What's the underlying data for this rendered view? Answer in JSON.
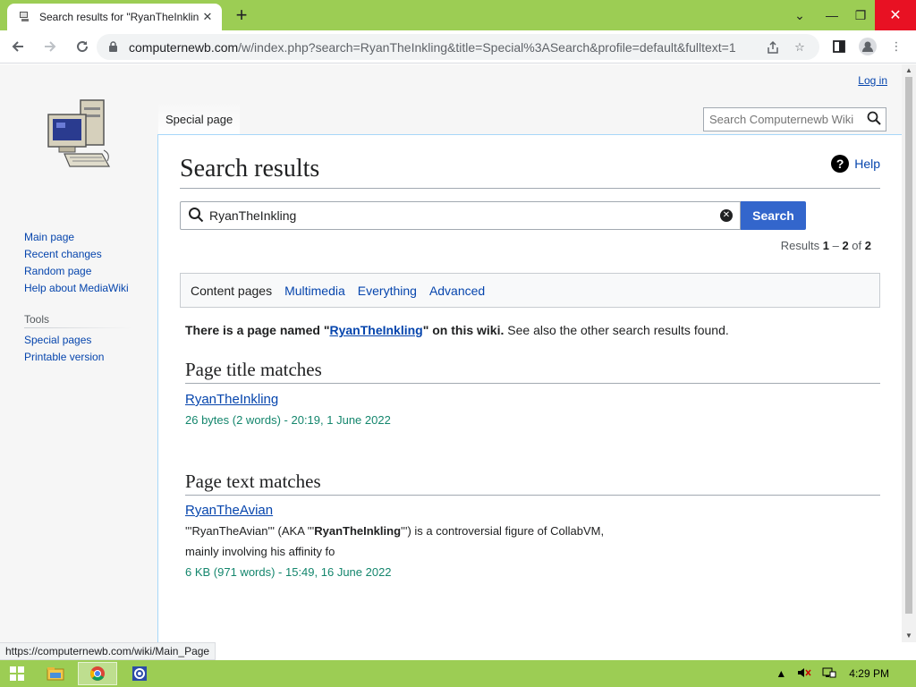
{
  "browser": {
    "tab_title": "Search results for \"RyanTheInklin",
    "url_host": "computernewb.com",
    "url_path": "/w/index.php?search=RyanTheInkling&title=Special%3ASearch&profile=default&fulltext=1",
    "status_url": "https://computernewb.com/wiki/Main_Page"
  },
  "wiki": {
    "login": "Log in",
    "namespace_tab": "Special page",
    "header_search_placeholder": "Search Computernewb Wiki",
    "sidebar": {
      "nav": [
        "Main page",
        "Recent changes",
        "Random page",
        "Help about MediaWiki"
      ],
      "tools_heading": "Tools",
      "tools": [
        "Special pages",
        "Printable version"
      ]
    },
    "page_title": "Search results",
    "help": "Help",
    "search_value": "RyanTheInkling",
    "search_button": "Search",
    "results_info": {
      "prefix": "Results ",
      "from": "1",
      "dash": " – ",
      "to": "2",
      "of": " of ",
      "total": "2"
    },
    "profiles": {
      "active": "Content pages",
      "links": [
        "Multimedia",
        "Everything",
        "Advanced"
      ]
    },
    "page_exists": {
      "before": "There is a page named \"",
      "link": "RyanTheInkling",
      "after": "\" on this wiki.",
      "rest": " See also the other search results found."
    },
    "title_matches": {
      "heading": "Page title matches",
      "title": "RyanTheInkling",
      "meta": "26 bytes (2 words) - 20:19, 1 June 2022"
    },
    "text_matches": {
      "heading": "Page text matches",
      "title": "RyanTheAvian",
      "snippet_before": "'''RyanTheAvian''' (AKA '''",
      "snippet_bold": "RyanTheInkling",
      "snippet_after": "''') is a controversial figure of CollabVM,",
      "snippet_line2": "mainly involving his affinity fo",
      "meta": "6 KB (971 words) - 15:49, 16 June 2022"
    }
  },
  "taskbar": {
    "clock": "4:29 PM"
  }
}
